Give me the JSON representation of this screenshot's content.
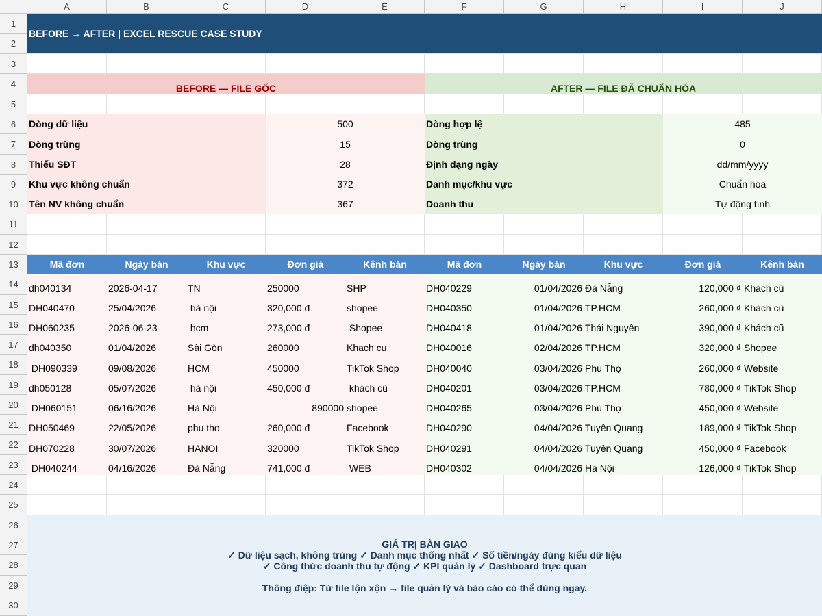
{
  "columns": [
    "A",
    "B",
    "C",
    "D",
    "E",
    "F",
    "G",
    "H",
    "I",
    "J"
  ],
  "rows": [
    "1",
    "2",
    "3",
    "4",
    "5",
    "6",
    "7",
    "8",
    "9",
    "10",
    "11",
    "12",
    "13",
    "14",
    "15",
    "16",
    "17",
    "18",
    "19",
    "20",
    "21",
    "22",
    "23",
    "24",
    "25",
    "26",
    "27",
    "28",
    "29",
    "30"
  ],
  "title": "BEFORE → AFTER | EXCEL RESCUE CASE STUDY",
  "before": {
    "heading": "BEFORE — FILE GỐC",
    "stats": [
      {
        "label": "Dòng dữ liệu",
        "value": "500"
      },
      {
        "label": "Dòng trùng",
        "value": "15"
      },
      {
        "label": "Thiếu SĐT",
        "value": "28"
      },
      {
        "label": "Khu vực không chuẩn",
        "value": "372"
      },
      {
        "label": "Tên NV không chuẩn",
        "value": "367"
      }
    ],
    "table_headers": [
      "Mã đơn",
      "Ngày bán",
      "Khu vực",
      "Đơn giá",
      "Kênh bán"
    ],
    "rows": [
      [
        "dh040134",
        "2026-04-17",
        "TN",
        "250000",
        "SHP"
      ],
      [
        "DH040470",
        "25/04/2026",
        " hà nội",
        "320,000 đ",
        "shopee"
      ],
      [
        "DH060235",
        "2026-06-23",
        " hcm",
        "273,000 đ",
        " Shopee"
      ],
      [
        "dh040350",
        "01/04/2026",
        "Sài Gòn",
        "260000",
        "Khach cu"
      ],
      [
        " DH090339",
        "09/08/2026",
        "HCM",
        "450000",
        "TikTok Shop"
      ],
      [
        "dh050128",
        "05/07/2026",
        " hà nội",
        "450,000 đ",
        " khách cũ"
      ],
      [
        " DH060151",
        "06/16/2026",
        "Hà Nội",
        "890000",
        "shopee"
      ],
      [
        "DH050469",
        "22/05/2026",
        "phu tho",
        "260,000 đ",
        "Facebook"
      ],
      [
        "DH070228",
        "30/07/2026",
        "HANOI",
        "320000",
        "TikTok Shop"
      ],
      [
        " DH040244",
        "04/16/2026",
        "Đà Nẵng",
        "741,000 đ",
        " WEB"
      ]
    ]
  },
  "after": {
    "heading": "AFTER — FILE ĐÃ CHUẨN HÓA",
    "stats": [
      {
        "label": "Dòng hợp lệ",
        "value": "485"
      },
      {
        "label": "Dòng trùng",
        "value": "0"
      },
      {
        "label": "Định dạng ngày",
        "value": "dd/mm/yyyy"
      },
      {
        "label": "Danh mục/khu vực",
        "value": "Chuẩn hóa"
      },
      {
        "label": "Doanh thu",
        "value": "Tự động tính"
      }
    ],
    "table_headers": [
      "Mã đơn",
      "Ngày bán",
      "Khu vực",
      "Đơn giá",
      "Kênh bán"
    ],
    "rows": [
      [
        "DH040229",
        "01/04/2026",
        "Đà Nẵng",
        "120,000 ₫",
        "Khách cũ"
      ],
      [
        "DH040350",
        "01/04/2026",
        "TP.HCM",
        "260,000 ₫",
        "Khách cũ"
      ],
      [
        "DH040418",
        "01/04/2026",
        "Thái Nguyên",
        "390,000 ₫",
        "Khách cũ"
      ],
      [
        "DH040016",
        "02/04/2026",
        "TP.HCM",
        "320,000 ₫",
        "Shopee"
      ],
      [
        "DH040040",
        "03/04/2026",
        "Phú Thọ",
        "260,000 ₫",
        "Website"
      ],
      [
        "DH040201",
        "03/04/2026",
        "TP.HCM",
        "780,000 ₫",
        "TikTok Shop"
      ],
      [
        "DH040265",
        "03/04/2026",
        "Phú Thọ",
        "450,000 ₫",
        "Website"
      ],
      [
        "DH040290",
        "04/04/2026",
        "Tuyên Quang",
        "189,000 ₫",
        "TikTok Shop"
      ],
      [
        "DH040291",
        "04/04/2026",
        "Tuyên Quang",
        "450,000 ₫",
        "Facebook"
      ],
      [
        "DH040302",
        "04/04/2026",
        "Hà Nội",
        "126,000 ₫",
        "TikTok Shop"
      ]
    ]
  },
  "summary": {
    "heading": "GIÁ TRỊ BÀN GIAO",
    "line1": "✓ Dữ liệu sạch, không trùng  ✓ Danh mục thống nhất  ✓ Số tiền/ngày đúng kiểu dữ liệu",
    "line2": "✓ Công thức doanh thu tự động  ✓ KPI quản lý  ✓ Dashboard trực quan",
    "message": "Thông điệp: Từ file lộn xộn → file quản lý và báo cáo có thể dùng ngay."
  }
}
